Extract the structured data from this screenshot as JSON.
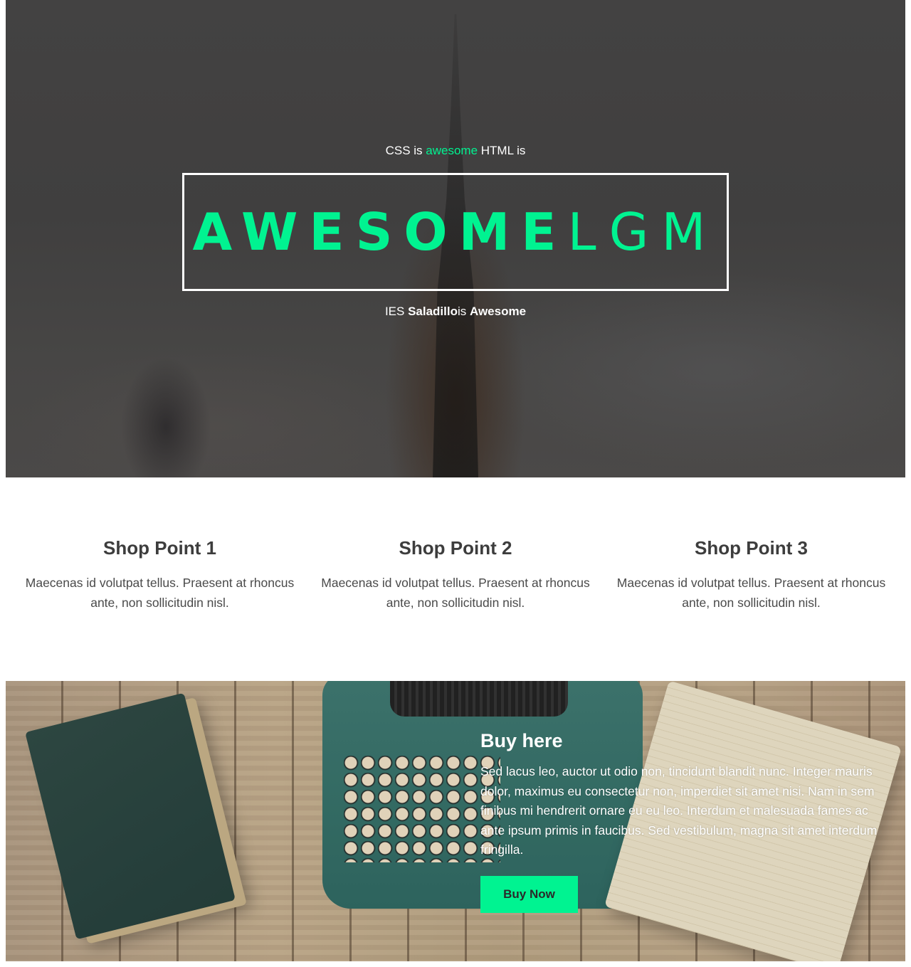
{
  "hero": {
    "tagline_prefix": "CSS is ",
    "tagline_accent": "awesome",
    "tagline_suffix": " HTML is",
    "title_bold": "AWESOME",
    "title_light": "LGM",
    "subline_prefix": "IES ",
    "subline_bold1": "Saladillo",
    "subline_middle": "is ",
    "subline_bold2": "Awesome"
  },
  "points": [
    {
      "title": "Shop Point 1",
      "text": "Maecenas id volutpat tellus. Praesent at rhoncus ante, non sollicitudin nisl."
    },
    {
      "title": "Shop Point 2",
      "text": "Maecenas id volutpat tellus. Praesent at rhoncus ante, non sollicitudin nisl."
    },
    {
      "title": "Shop Point 3",
      "text": "Maecenas id volutpat tellus. Praesent at rhoncus ante, non sollicitudin nisl."
    }
  ],
  "buy": {
    "title": "Buy here",
    "text": "Sed lacus leo, auctor ut odio non, tincidunt blandit nunc. Integer mauris dolor, maximus eu consectetur non, imperdiet sit amet nisi. Nam in sem finibus mi hendrerit ornare eu eu leo. Interdum et malesuada fames ac ante ipsum primis in faucibus. Sed vestibulum, magna sit amet interdum fringilla.",
    "button_label": "Buy Now"
  },
  "colors": {
    "accent": "#00f391",
    "hero_overlay": "#434242",
    "heading": "#3d3d3d"
  }
}
